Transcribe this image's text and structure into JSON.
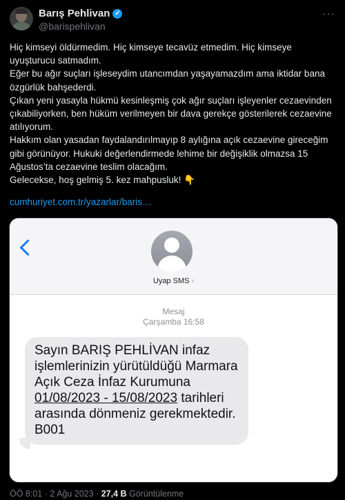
{
  "author": {
    "name": "Barış Pehlivan",
    "handle": "@barispehlivan",
    "verified_icon": "verified-badge-icon",
    "more_icon": "more-options-icon"
  },
  "tweet": {
    "lines": [
      "Hiç kimseyi öldürmedim. Hiç kimseye tecavüz etmedim. Hiç kimseye uyuşturucu satmadım.",
      "Eğer bu ağır suçları işleseydim utancımdan yaşayamazdım ama iktidar bana özgürlük bahşederdi.",
      "Çıkan yeni yasayla hükmü kesinleşmiş çok ağır suçları işleyenler cezaevinden çıkabiliyorken, ben hüküm verilmeyen bir dava gerekçe gösterilerek cezaevine atılıyorum.",
      "Hakkım olan yasadan faydalandırılmayıp 8 aylığına açık cezaevine gireceğim gibi görünüyor. Hukuki değerlendirmede lehime bir değişiklik olmazsa 15 Ağustos’ta cezaevine teslim olacağım.",
      "Gelecekse, hoş gelmiş 5. kez mahpusluk! 👇"
    ],
    "link": "cumhuriyet.com.tr/yazarlar/baris…"
  },
  "sms": {
    "back_icon": "chevron-left-icon",
    "contact_name": "Uyap SMS",
    "contact_chevron": "›",
    "meta_label": "Mesaj",
    "meta_time": "Çarşamba 16:58",
    "message_part1": "Sayın  BARIŞ PEHLİVAN  infaz işlemlerinizin yürütüldüğü Marmara Açık Ceza İnfaz Kurumuna ",
    "message_dates": "01/08/2023 - 15/08/2023",
    "message_part2": " tarihleri arasında dönmeniz gerekmektedir. B001"
  },
  "footer": {
    "time_date": "ÖÖ 8:01 · 2 Ağu 2023 · ",
    "views_count": "27,4 B",
    "views_label": " Görüntülenme"
  },
  "colors": {
    "background": "#000000",
    "text": "#e7e9ea",
    "secondary": "#71767b",
    "link": "#1d9bf0",
    "bubble": "#e9e9eb"
  }
}
